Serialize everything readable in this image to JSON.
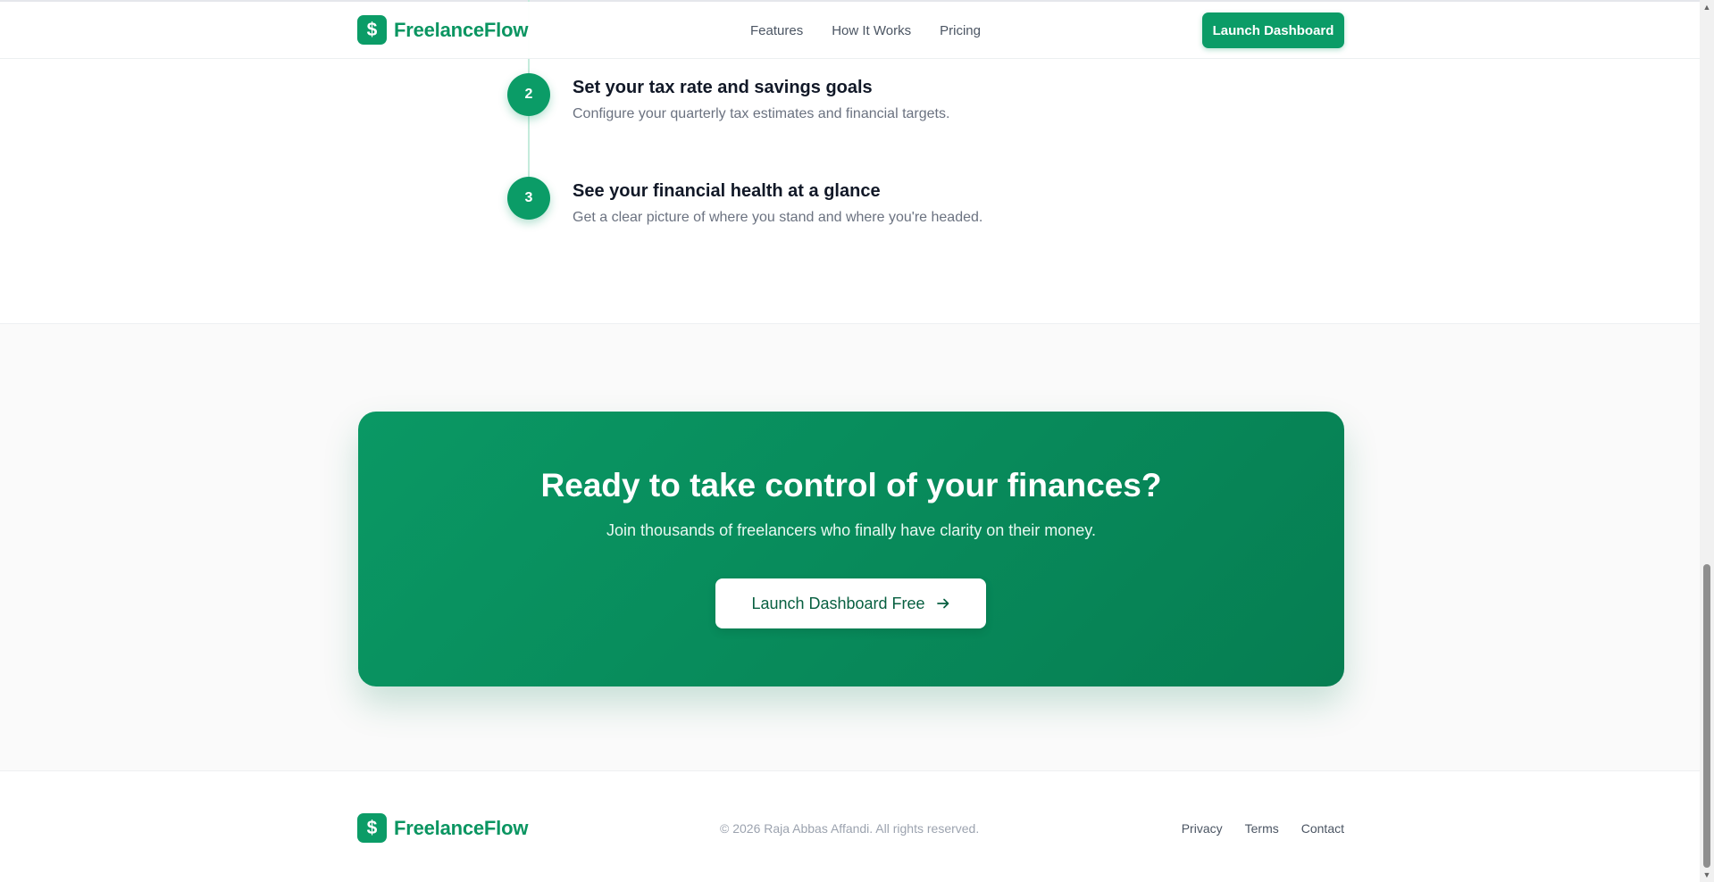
{
  "header": {
    "brand_icon": "$",
    "brand_name": "FreelanceFlow",
    "nav": [
      "Features",
      "How It Works",
      "Pricing"
    ],
    "cta_label": "Launch Dashboard"
  },
  "steps": [
    {
      "number": "2",
      "title": "Set your tax rate and savings goals",
      "description": "Configure your quarterly tax estimates and financial targets."
    },
    {
      "number": "3",
      "title": "See your financial health at a glance",
      "description": "Get a clear picture of where you stand and where you're headed."
    }
  ],
  "cta": {
    "title": "Ready to take control of your finances?",
    "subtitle": "Join thousands of freelancers who finally have clarity on their money.",
    "button_label": "Launch Dashboard Free",
    "button_icon": "arrow-right-icon"
  },
  "footer": {
    "brand_icon": "$",
    "brand_name": "FreelanceFlow",
    "copyright": "© 2026 Raja Abbas Affandi. All rights reserved.",
    "links": [
      "Privacy",
      "Terms",
      "Contact"
    ]
  },
  "colors": {
    "brand": "#0b9c67",
    "cta_gradient_start": "#0a9864",
    "cta_gradient_end": "#067e52"
  }
}
